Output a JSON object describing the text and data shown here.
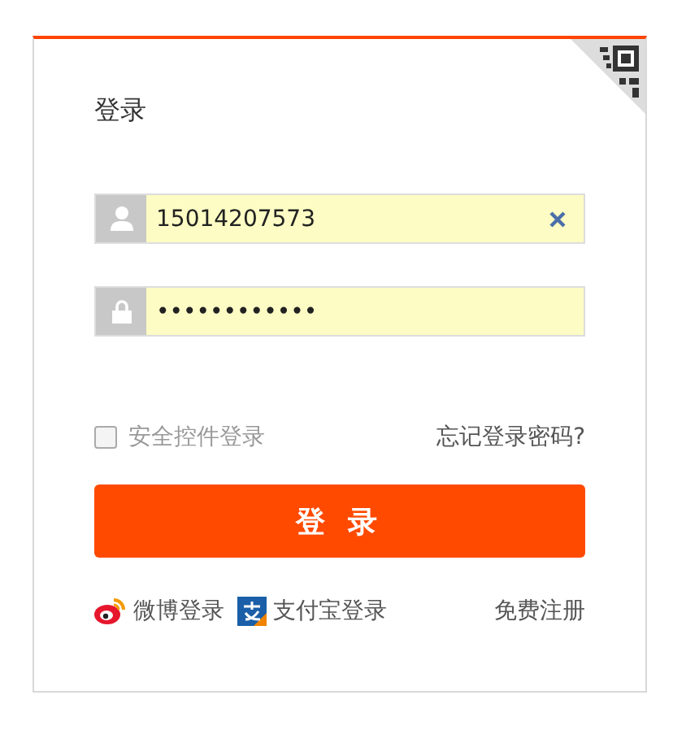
{
  "title": "登录",
  "username": {
    "value": "15014207573"
  },
  "password": {
    "value": "••••••••••••"
  },
  "secure_login": {
    "label": "安全控件登录",
    "checked": false
  },
  "forgot_link": "忘记登录密码?",
  "login_button": "登 录",
  "third_party": [
    {
      "kind": "weibo",
      "label": "微博登录"
    },
    {
      "kind": "alipay",
      "label": "支付宝登录"
    }
  ],
  "register_link": "免费注册"
}
